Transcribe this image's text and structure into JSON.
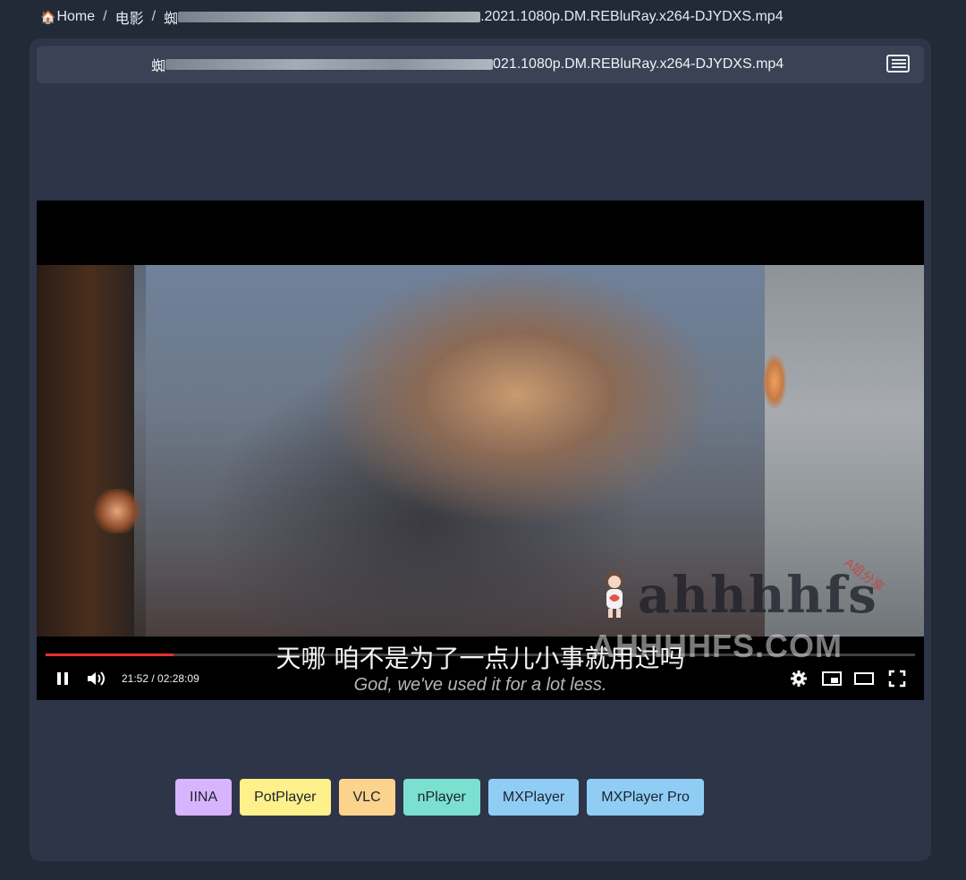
{
  "breadcrumb": {
    "home_label": "Home",
    "home_icon": "house-icon",
    "separator": "/",
    "folder": "电影",
    "file_prefix": "蜘",
    "file_suffix": ".2021.1080p.DM.REBluRay.x264-DJYDXS.mp4"
  },
  "title_bar": {
    "prefix": "蜘",
    "suffix": "021.1080p.DM.REBluRay.x264-DJYDXS.mp4",
    "playlist_icon": "playlist-icon"
  },
  "video": {
    "subtitle_cn": "天哪  咱不是为了一点儿小事就用过吗",
    "subtitle_en": "God, we've used it for a lot less.",
    "watermark_logo": "ahhhhfs",
    "watermark_tag": "A姐分享",
    "watermark_url": "AHHHHFS.COM",
    "current_time": "21:52",
    "duration": "02:28:09",
    "time_display": "21:52 / 02:28:09",
    "progress_fraction": 0.147,
    "progress_color": "#e53030"
  },
  "players": [
    {
      "label": "IINA",
      "color": "#d8b4fe"
    },
    {
      "label": "PotPlayer",
      "color": "#fef08a"
    },
    {
      "label": "VLC",
      "color": "#fcd38d"
    },
    {
      "label": "nPlayer",
      "color": "#7be0cf"
    },
    {
      "label": "MXPlayer",
      "color": "#90cdf4"
    },
    {
      "label": "MXPlayer Pro",
      "color": "#90cdf4"
    }
  ]
}
